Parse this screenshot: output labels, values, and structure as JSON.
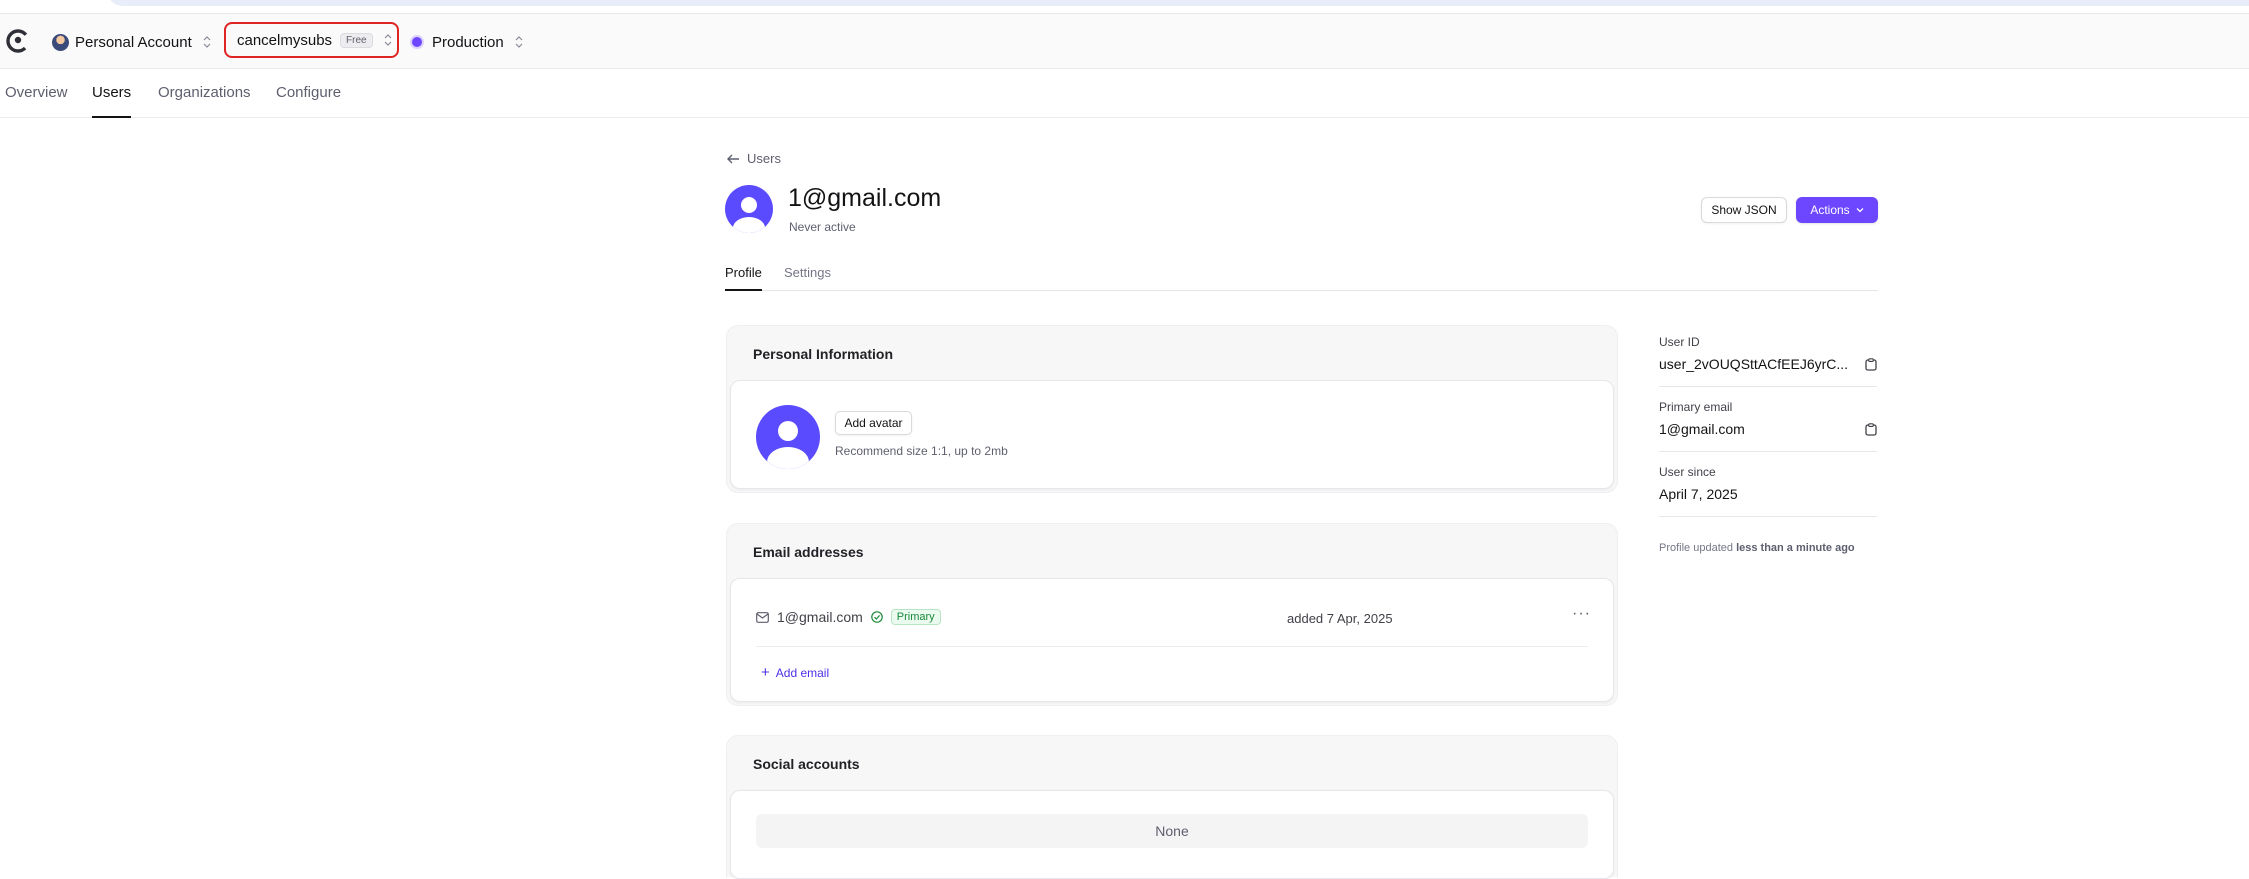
{
  "header": {
    "account_name": "Personal Account",
    "app_name": "cancelmysubs",
    "plan_badge": "Free",
    "environment": "Production"
  },
  "nav": {
    "tabs": [
      {
        "label": "Overview"
      },
      {
        "label": "Users"
      },
      {
        "label": "Organizations"
      },
      {
        "label": "Configure"
      }
    ],
    "active": "Users"
  },
  "user": {
    "back_label": "Users",
    "title": "1@gmail.com",
    "status": "Never active",
    "show_json_label": "Show JSON",
    "actions_label": "Actions"
  },
  "subtabs": [
    {
      "label": "Profile"
    },
    {
      "label": "Settings"
    }
  ],
  "personal_info": {
    "title": "Personal Information",
    "add_avatar_label": "Add avatar",
    "hint": "Recommend size 1:1, up to 2mb"
  },
  "emails": {
    "title": "Email addresses",
    "items": [
      {
        "address": "1@gmail.com",
        "badge": "Primary",
        "added": "added 7 Apr, 2025"
      }
    ],
    "more_label": "···",
    "add_label": "Add email"
  },
  "social": {
    "title": "Social accounts",
    "empty": "None"
  },
  "sidebar": {
    "user_id_label": "User ID",
    "user_id": "user_2vOUQSttACfEEJ6yrC...",
    "primary_email_label": "Primary email",
    "primary_email": "1@gmail.com",
    "user_since_label": "User since",
    "user_since": "April 7, 2025",
    "updated_prefix": "Profile updated",
    "updated_value": "less than a minute ago"
  },
  "colors": {
    "accent": "#6c47ff",
    "highlight_border": "#e02424",
    "avatar": "#5b4bff",
    "success": "#1a8a3b"
  }
}
